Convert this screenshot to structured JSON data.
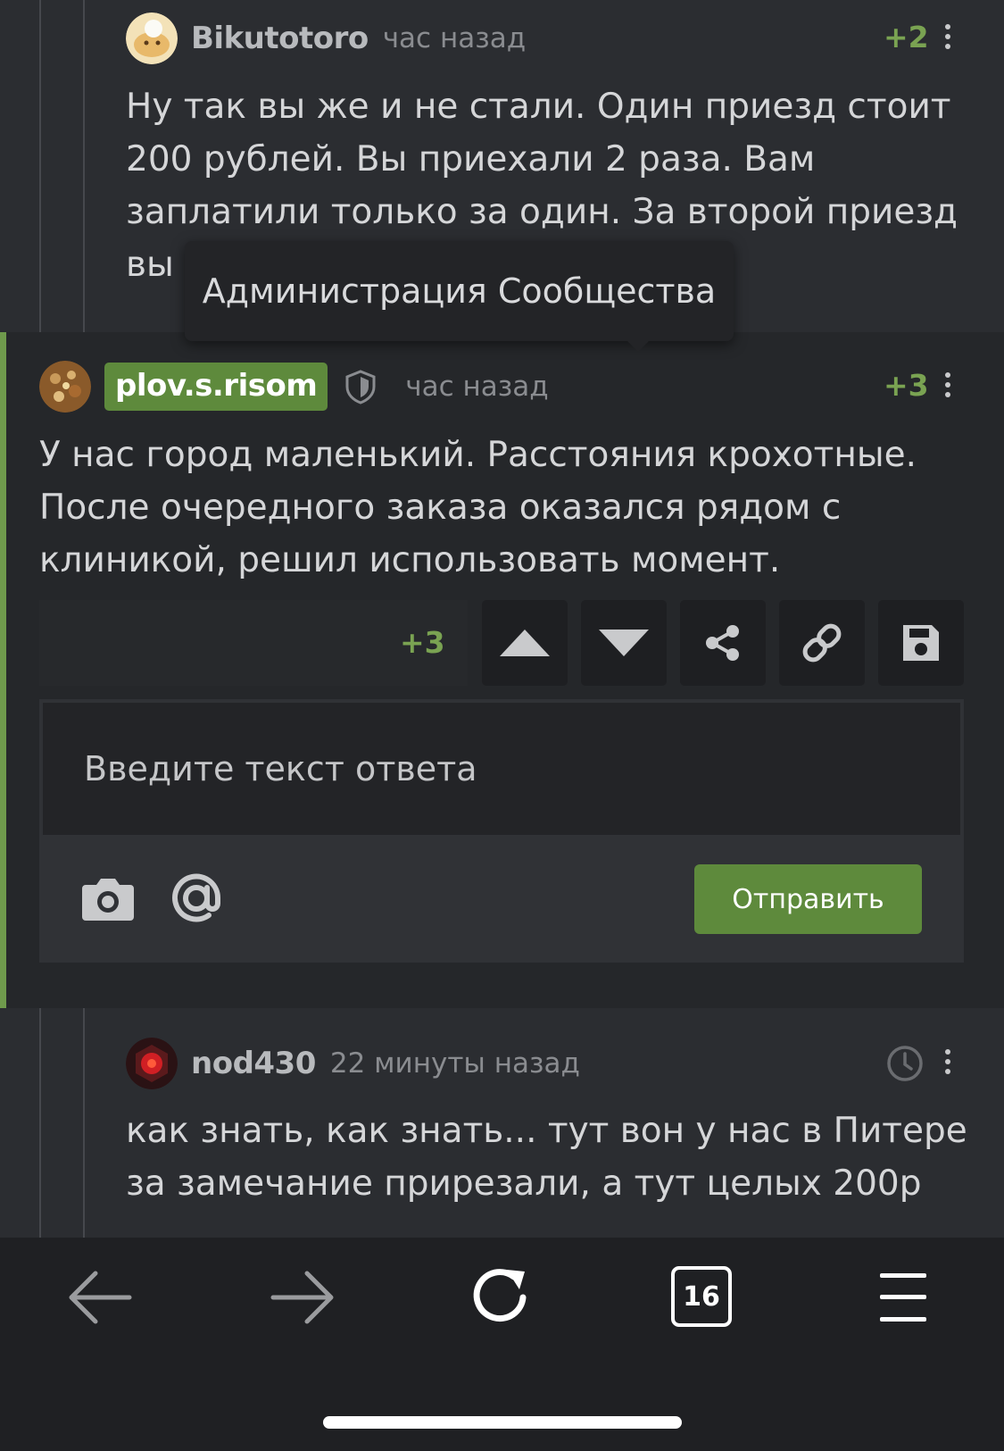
{
  "comments": [
    {
      "username": "Bikutotoro",
      "time": "час назад",
      "rating": "+2",
      "text": "Ну так вы же и не стали. Один приезд стоит\n200 рублей. Вы приехали 2 раза. Вам\nзаплатили только за один. За второй приезд\nвы"
    },
    {
      "username": "plov.s.risom",
      "time": "час назад",
      "rating": "+3",
      "text": "У нас город маленький. Расстояния крохотные.\nПосле очередного заказа оказался рядом с\nклиникой, решил использовать момент."
    },
    {
      "username": "nod430",
      "time": "22 минуты назад",
      "text": "как знать, как знать... тут вон у нас в Питере\nза замечание прирезали, а тут целых 200р"
    }
  ],
  "tooltip": "Администрация Сообщества",
  "actions": {
    "rating": "+3",
    "icons": [
      "upvote-icon",
      "downvote-icon",
      "share-icon",
      "link-icon",
      "save-icon"
    ]
  },
  "reply": {
    "placeholder": "Введите текст ответа",
    "send_label": "Отправить"
  },
  "browser": {
    "tabs_count": "16"
  },
  "colors": {
    "accent": "#6f9a4c",
    "rating": "#7aa352",
    "background": "#2b2d31"
  }
}
